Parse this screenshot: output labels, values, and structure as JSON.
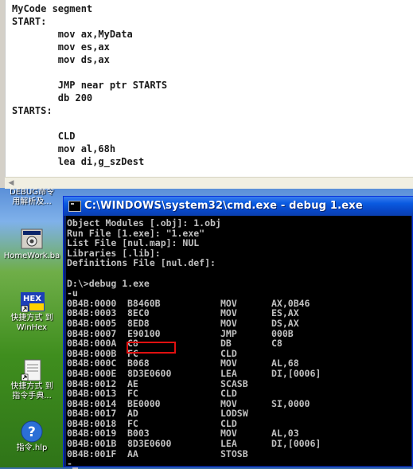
{
  "editor": {
    "code_lines": [
      "MyCode segment",
      "START:",
      "        mov ax,MyData",
      "        mov es,ax",
      "        mov ds,ax",
      "",
      "        JMP near ptr STARTS",
      "        db 200",
      "STARTS:",
      "",
      "        CLD",
      "        mov al,68h",
      "        lea di,g_szDest"
    ]
  },
  "desktop": {
    "icons": [
      {
        "label": "DEBUG命令\n用解析及..."
      },
      {
        "label": "HomeWork.ba"
      },
      {
        "label": "快捷方式 到\nWinHex"
      },
      {
        "label": "快捷方式 到\n指令手典..."
      },
      {
        "label": "指令.hlp"
      }
    ]
  },
  "cmd": {
    "title": "C:\\WINDOWS\\system32\\cmd.exe - debug 1.exe",
    "header_lines": [
      "Object Modules [.obj]: 1.obj",
      "Run File [1.exe]: \"1.exe\"",
      "List File [nul.map]: NUL",
      "Libraries [.lib]:",
      "Definitions File [nul.def]:",
      "",
      "D:\\>debug 1.exe",
      "-u"
    ],
    "disasm": [
      {
        "addr": "0B4B:0000",
        "bytes": "B8460B",
        "op": "MOV",
        "args": "AX,0B46"
      },
      {
        "addr": "0B4B:0003",
        "bytes": "8EC0",
        "op": "MOV",
        "args": "ES,AX"
      },
      {
        "addr": "0B4B:0005",
        "bytes": "8ED8",
        "op": "MOV",
        "args": "DS,AX"
      },
      {
        "addr": "0B4B:0007",
        "bytes": "E90100",
        "op": "JMP",
        "args": "000B"
      },
      {
        "addr": "0B4B:000A",
        "bytes": "C8",
        "op": "DB",
        "args": "C8"
      },
      {
        "addr": "0B4B:000B",
        "bytes": "FC",
        "op": "CLD",
        "args": ""
      },
      {
        "addr": "0B4B:000C",
        "bytes": "B068",
        "op": "MOV",
        "args": "AL,68"
      },
      {
        "addr": "0B4B:000E",
        "bytes": "8D3E0600",
        "op": "LEA",
        "args": "DI,[0006]"
      },
      {
        "addr": "0B4B:0012",
        "bytes": "AE",
        "op": "SCASB",
        "args": ""
      },
      {
        "addr": "0B4B:0013",
        "bytes": "FC",
        "op": "CLD",
        "args": ""
      },
      {
        "addr": "0B4B:0014",
        "bytes": "BE0000",
        "op": "MOV",
        "args": "SI,0000"
      },
      {
        "addr": "0B4B:0017",
        "bytes": "AD",
        "op": "LODSW",
        "args": ""
      },
      {
        "addr": "0B4B:0018",
        "bytes": "FC",
        "op": "CLD",
        "args": ""
      },
      {
        "addr": "0B4B:0019",
        "bytes": "B003",
        "op": "MOV",
        "args": "AL,03"
      },
      {
        "addr": "0B4B:001B",
        "bytes": "8D3E0600",
        "op": "LEA",
        "args": "DI,[0006]"
      },
      {
        "addr": "0B4B:001F",
        "bytes": "AA",
        "op": "STOSB",
        "args": ""
      }
    ],
    "prompt": "-",
    "highlight_color": "#e01010"
  }
}
